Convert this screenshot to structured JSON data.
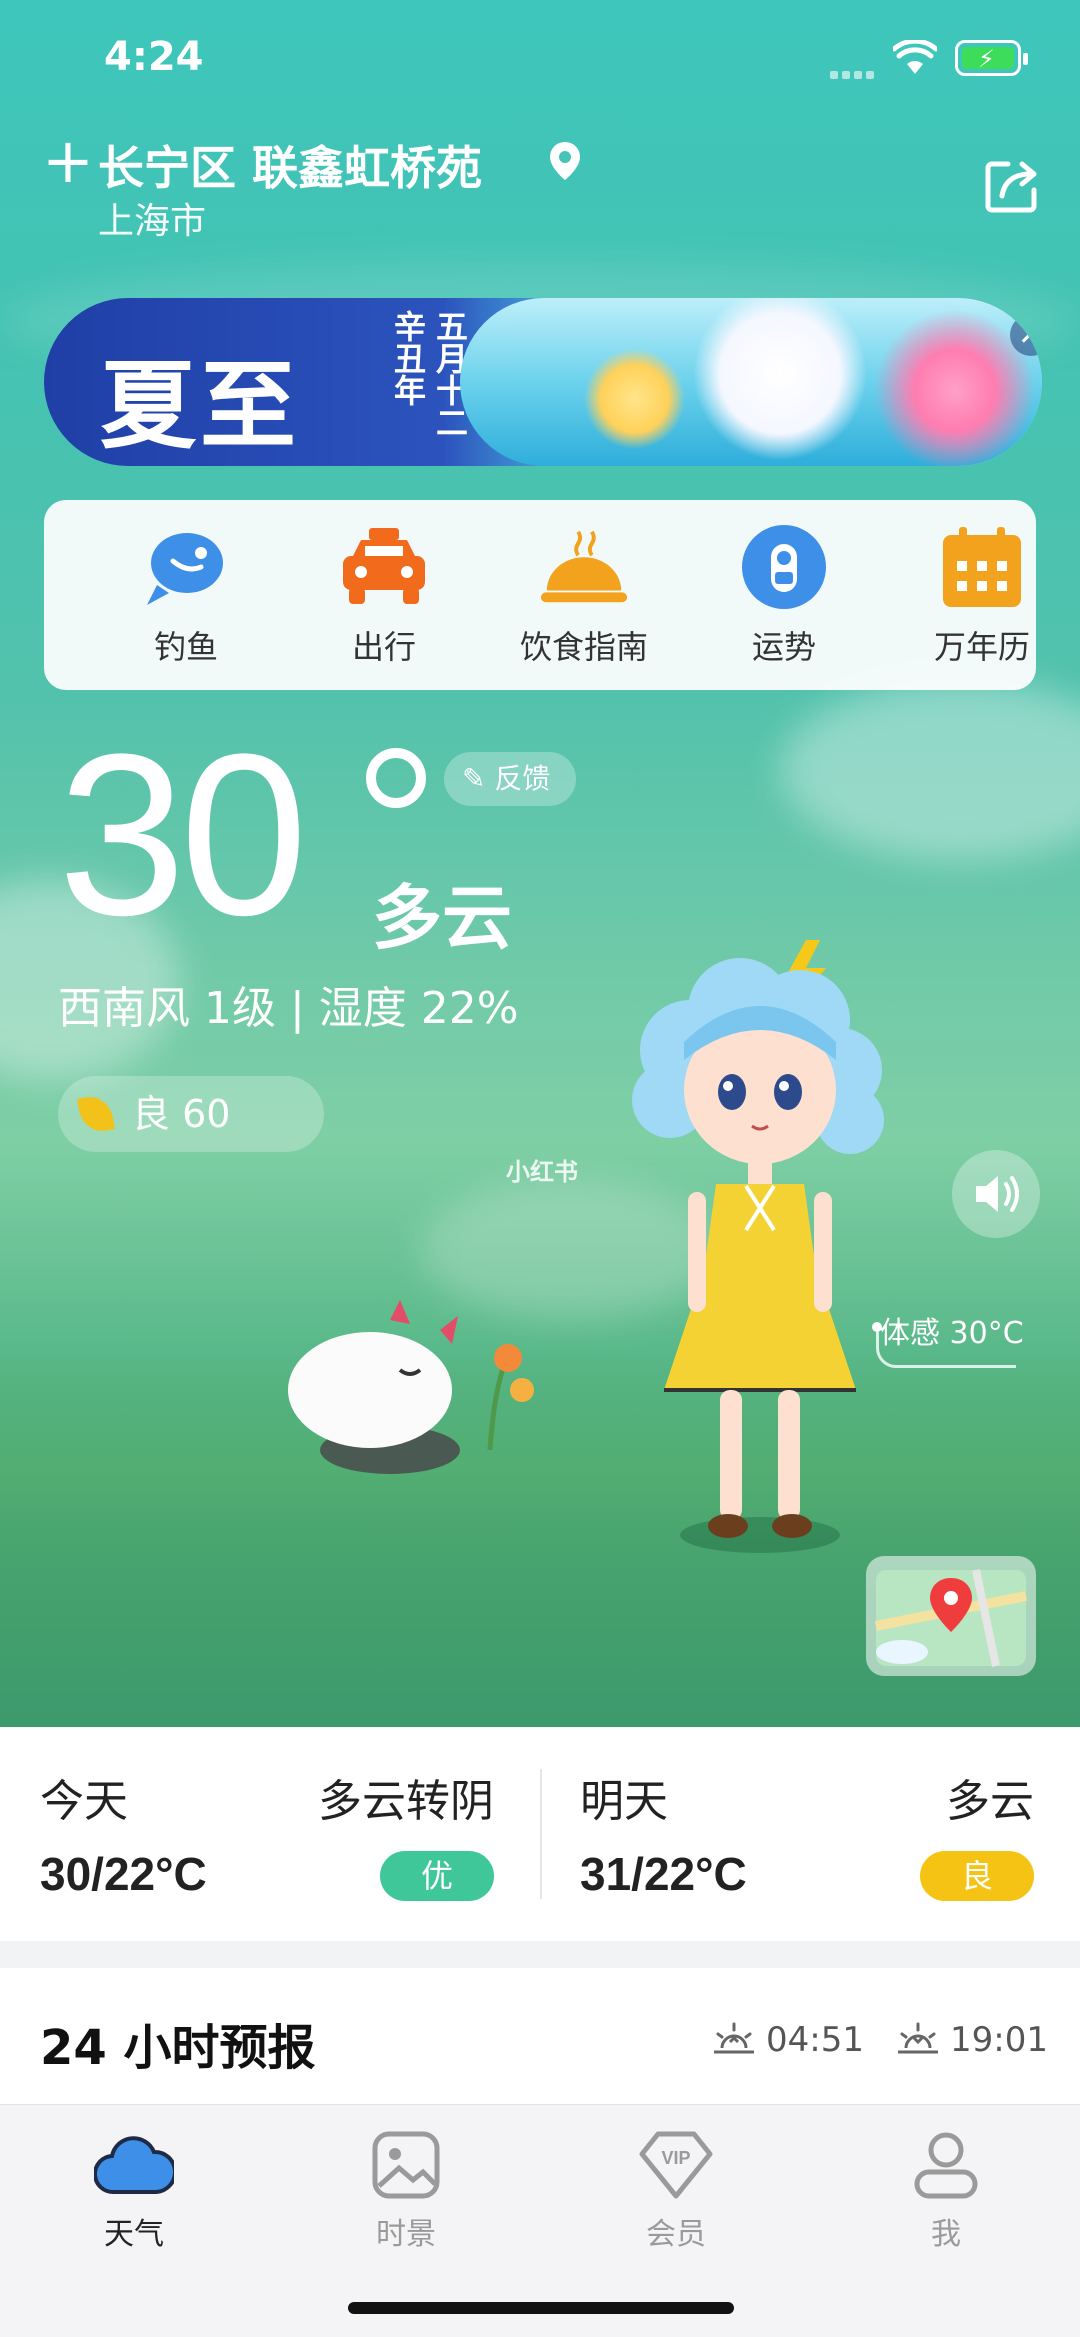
{
  "status_bar": {
    "time": "4:24"
  },
  "location": {
    "add_symbol": "+",
    "district": "长宁区 联鑫虹桥苑",
    "city": "上海市"
  },
  "banner": {
    "title": "夏至",
    "lunar_line1": "五月十二",
    "lunar_line2": "辛丑年",
    "close": "✕"
  },
  "tools": [
    {
      "label": "钓鱼",
      "icon": "fish-icon",
      "color": "#3d8fe8"
    },
    {
      "label": "出行",
      "icon": "taxi-icon",
      "color": "#f26b1d"
    },
    {
      "label": "饮食指南",
      "icon": "food-dome-icon",
      "color": "#f2a21d"
    },
    {
      "label": "运势",
      "icon": "fortune-icon",
      "color": "#3d8fe8"
    },
    {
      "label": "万年历",
      "icon": "calendar-icon",
      "color": "#f2a21d"
    }
  ],
  "current": {
    "temperature": "30",
    "condition": "多云",
    "wind_humidity": "西南风 1级 | 湿度 22%",
    "feedback": "反馈",
    "aqi": "良 60",
    "feels_like": "体感 30°C",
    "watermark": "小红书"
  },
  "summary": {
    "today": {
      "label": "今天",
      "condition": "多云转阴",
      "range": "30/22°C",
      "aqi": "优",
      "aqi_color": "#3fc79a"
    },
    "tomorrow": {
      "label": "明天",
      "condition": "多云",
      "range": "31/22°C",
      "aqi": "良",
      "aqi_color": "#f5c314"
    }
  },
  "hourly": {
    "title": "24 小时预报",
    "sunrise": "04:51",
    "sunset": "19:01"
  },
  "tabbar": [
    {
      "label": "天气",
      "icon": "cloud-icon",
      "active": true
    },
    {
      "label": "时景",
      "icon": "picture-icon",
      "active": false
    },
    {
      "label": "会员",
      "icon": "vip-icon",
      "active": false
    },
    {
      "label": "我",
      "icon": "profile-icon",
      "active": false
    }
  ],
  "colors": {
    "sky_top": "#3ec6bc",
    "accent_green": "#3fc79a",
    "accent_yellow": "#f5c314"
  }
}
